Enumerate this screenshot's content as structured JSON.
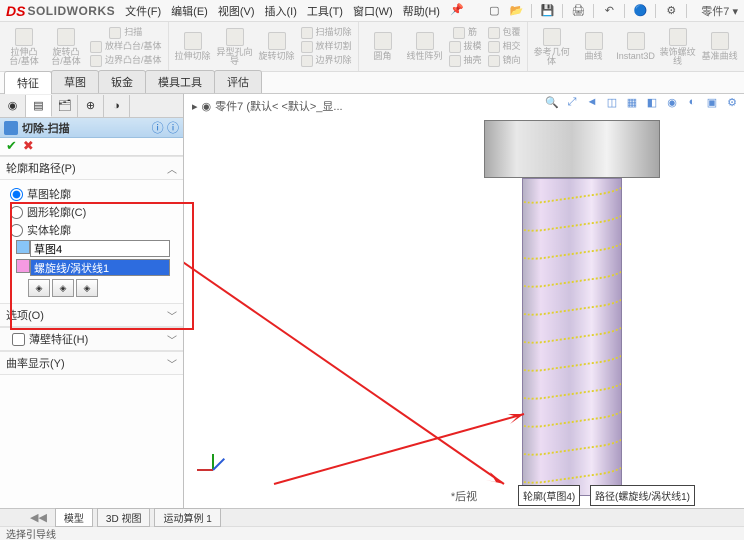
{
  "title": {
    "app": "SOLIDWORKS",
    "doc": "零件7 ▾"
  },
  "menu": {
    "file": "文件(F)",
    "edit": "编辑(E)",
    "view": "视图(V)",
    "insert": "插入(I)",
    "tools": "工具(T)",
    "window": "窗口(W)",
    "help": "帮助(H)"
  },
  "ribbon": {
    "g1a": "拉伸凸台/基体",
    "g1b": "旋转凸台/基体",
    "g1c": "扫描",
    "g1d": "放样凸台/基体",
    "g1e": "边界凸台/基体",
    "g2a": "拉伸切除",
    "g2b": "异型孔向导",
    "g2c": "旋转切除",
    "g2d": "扫描切除",
    "g2e": "放样切割",
    "g2f": "边界切除",
    "g3a": "圆角",
    "g3b": "线性阵列",
    "g3c": "筋",
    "g3d": "拔模",
    "g3e": "抽壳",
    "g3f": "包覆",
    "g3g": "相交",
    "g3h": "镜向",
    "g4a": "参考几何体",
    "g4b": "曲线",
    "g4c": "Instant3D",
    "g4d": "装饰螺纹线",
    "g4e": "基准曲线"
  },
  "tabs": {
    "feature": "特征",
    "sketch": "草图",
    "sheetmetal": "钣金",
    "moldtools": "模具工具",
    "evaluate": "评估"
  },
  "feature": {
    "title": "切除-扫描",
    "section_profile": "轮廓和路径(P)",
    "radio_sketch": "草图轮廓",
    "radio_circle": "圆形轮廓(C)",
    "radio_solid": "实体轮廓",
    "input_profile": "草图4",
    "input_path": "螺旋线/涡状线1",
    "section_options": "选项(O)",
    "check_thin": "薄壁特征(H)",
    "section_curve": "曲率显示(Y)"
  },
  "viewport": {
    "breadcrumb": "零件7 (默认< <默认>_显...",
    "viewname": "*后视",
    "tag_profile": "轮廓(草图4)",
    "tag_path": "路径(螺旋线/涡状线1)"
  },
  "bottomtabs": {
    "model": "模型",
    "view3d": "3D 视图",
    "motion": "运动算例 1"
  },
  "status": {
    "text": "选择引导线"
  }
}
